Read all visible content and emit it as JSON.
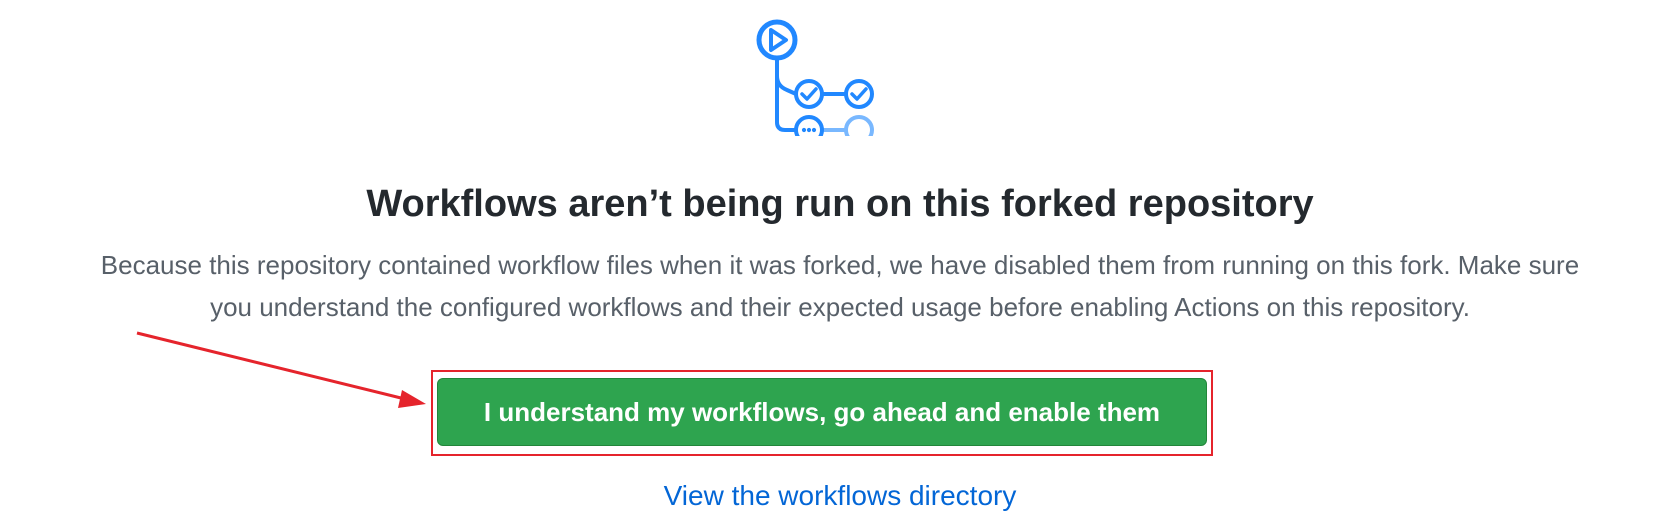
{
  "blankslate": {
    "icon": "github-actions-workflow-icon",
    "title": "Workflows aren’t being run on this forked repository",
    "description_line1": "Because this repository contained workflow files when it was forked, we have disabled them from running on this fork. Make sure",
    "description_line2": "you understand the configured workflows and their expected usage before enabling Actions on this repository.",
    "enable_button_label": "I understand my workflows, go ahead and enable them",
    "view_link_label": "View the workflows directory"
  },
  "annotations": {
    "highlight_color": "#e5242c",
    "arrow_color": "#e5242c"
  },
  "colors": {
    "button_green": "#2ea44f",
    "link_blue": "#0366d6",
    "icon_blue": "#2188ff",
    "icon_light_blue": "#79b8ff"
  }
}
